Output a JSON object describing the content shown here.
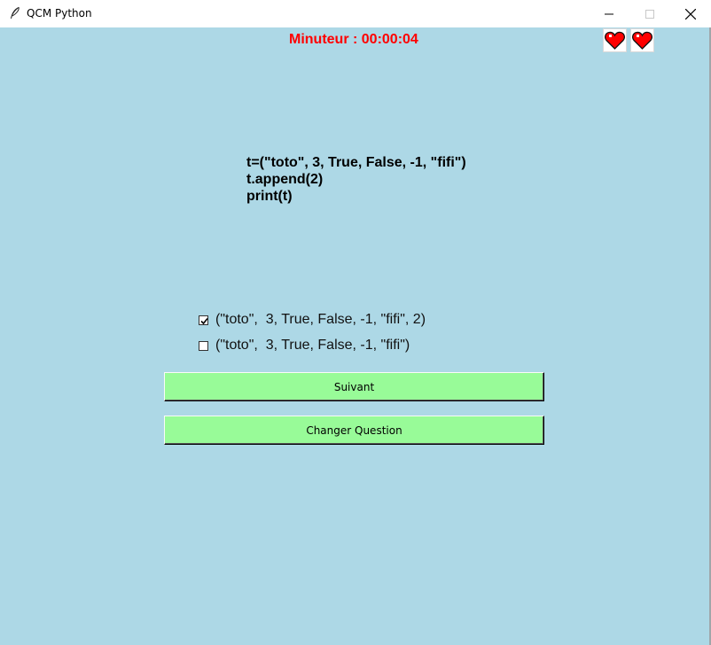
{
  "window": {
    "title": "QCM Python",
    "icon": "feather-icon",
    "controls": [
      "minimize-icon",
      "maximize-icon",
      "close-icon"
    ]
  },
  "timer": {
    "text": "Minuteur : 00:00:04",
    "color": "#ff0000"
  },
  "lives": {
    "count": 2,
    "icon": "heart-icon",
    "color": "#ff0000"
  },
  "question": {
    "code_lines": [
      "t=(\"toto\", 3, True, False, -1, \"fifi\")",
      "t.append(2)",
      "print(t)"
    ]
  },
  "options": [
    {
      "label": "(\"toto\",  3, True, False, -1, \"fifi\", 2)",
      "checked": true
    },
    {
      "label": "(\"toto\",  3, True, False, -1, \"fifi\")",
      "checked": false
    }
  ],
  "buttons": {
    "next": "Suivant",
    "change": "Changer Question"
  },
  "colors": {
    "background": "#add8e6",
    "button": "#98fb98"
  }
}
